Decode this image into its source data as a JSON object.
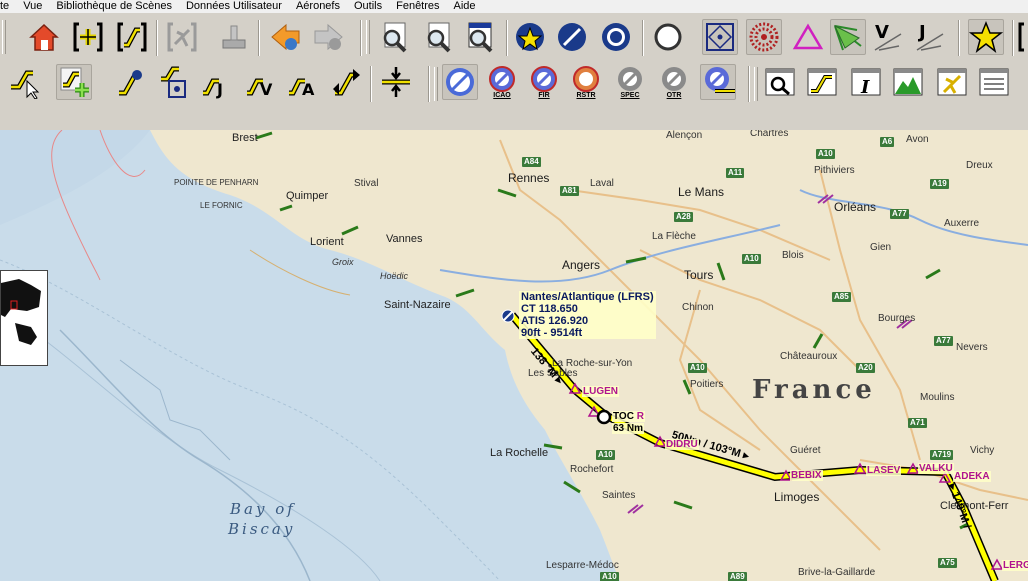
{
  "menu": [
    "te",
    "Vue",
    "Bibliothèque de Scènes",
    "Données Utilisateur",
    "Aéronefs",
    "Outils",
    "Fenêtres",
    "Aide"
  ],
  "toolbar2_labels": {
    "icao": "ICAO",
    "fir": "FIR",
    "rstr": "RSTR",
    "spec": "SPEC",
    "otr": "OTR"
  },
  "map": {
    "country": "France",
    "sea": [
      "Bay of",
      "Biscay"
    ],
    "cities": [
      {
        "name": "Brest"
      },
      {
        "name": "Quimper"
      },
      {
        "name": "Stival"
      },
      {
        "name": "Lorient"
      },
      {
        "name": "Vannes"
      },
      {
        "name": "Rennes"
      },
      {
        "name": "Laval"
      },
      {
        "name": "Le Mans"
      },
      {
        "name": "Alençon"
      },
      {
        "name": "Chartres"
      },
      {
        "name": "Pithiviers"
      },
      {
        "name": "Orléans"
      },
      {
        "name": "Avon"
      },
      {
        "name": "Dreux"
      },
      {
        "name": "Auxerre"
      },
      {
        "name": "La Flèche"
      },
      {
        "name": "Angers"
      },
      {
        "name": "Tours"
      },
      {
        "name": "Blois"
      },
      {
        "name": "Gien"
      },
      {
        "name": "Chinon"
      },
      {
        "name": "Bourges"
      },
      {
        "name": "Saint-Nazaire"
      },
      {
        "name": "Hoëdic"
      },
      {
        "name": "Groix"
      },
      {
        "name": "POINTE DE PENHARN"
      },
      {
        "name": "LE FORNIC"
      },
      {
        "name": "Châteauroux"
      },
      {
        "name": "Nevers"
      },
      {
        "name": "Poitiers"
      },
      {
        "name": "Moulins"
      },
      {
        "name": "La Rochelle"
      },
      {
        "name": "Rochefort"
      },
      {
        "name": "Saintes"
      },
      {
        "name": "Guéret"
      },
      {
        "name": "Limoges"
      },
      {
        "name": "Vichy"
      },
      {
        "name": "Clermont-Ferr"
      },
      {
        "name": "Lesparre-Médoc"
      },
      {
        "name": "Brive-la-Gaillarde"
      },
      {
        "name": "La Roche-sur-Yon"
      },
      {
        "name": "Les Sables"
      }
    ],
    "roads": [
      "A84",
      "A81",
      "A11",
      "A28",
      "A10",
      "A19",
      "A77",
      "A6",
      "A10",
      "A85",
      "A10",
      "A77",
      "A71",
      "A20",
      "A719",
      "A89",
      "A75",
      "A10",
      "A10"
    ],
    "airport_info": {
      "name": "Nantes/Atlantique (LFRS)",
      "ct": "CT 118.650",
      "atis": "ATIS 126.920",
      "elev": "90ft - 9514ft"
    },
    "route_labels": {
      "leg1": "138 °M ▸",
      "leg2": "50Nm / 103°M ▸",
      "leg3": "▸ 149°M /"
    },
    "waypoints": [
      "LUGEN",
      "TOC",
      "63 Nm",
      "DIDRU",
      "BEBIX",
      "LASEV",
      "VALKU",
      "ADEKA",
      "LERG"
    ],
    "toc_suffix": "R"
  },
  "colors": {
    "route": "#ffff00",
    "route_outline": "#000000",
    "waypoint": "#b0138e",
    "land": "#efe7cf",
    "sea": "#c9dcea"
  }
}
